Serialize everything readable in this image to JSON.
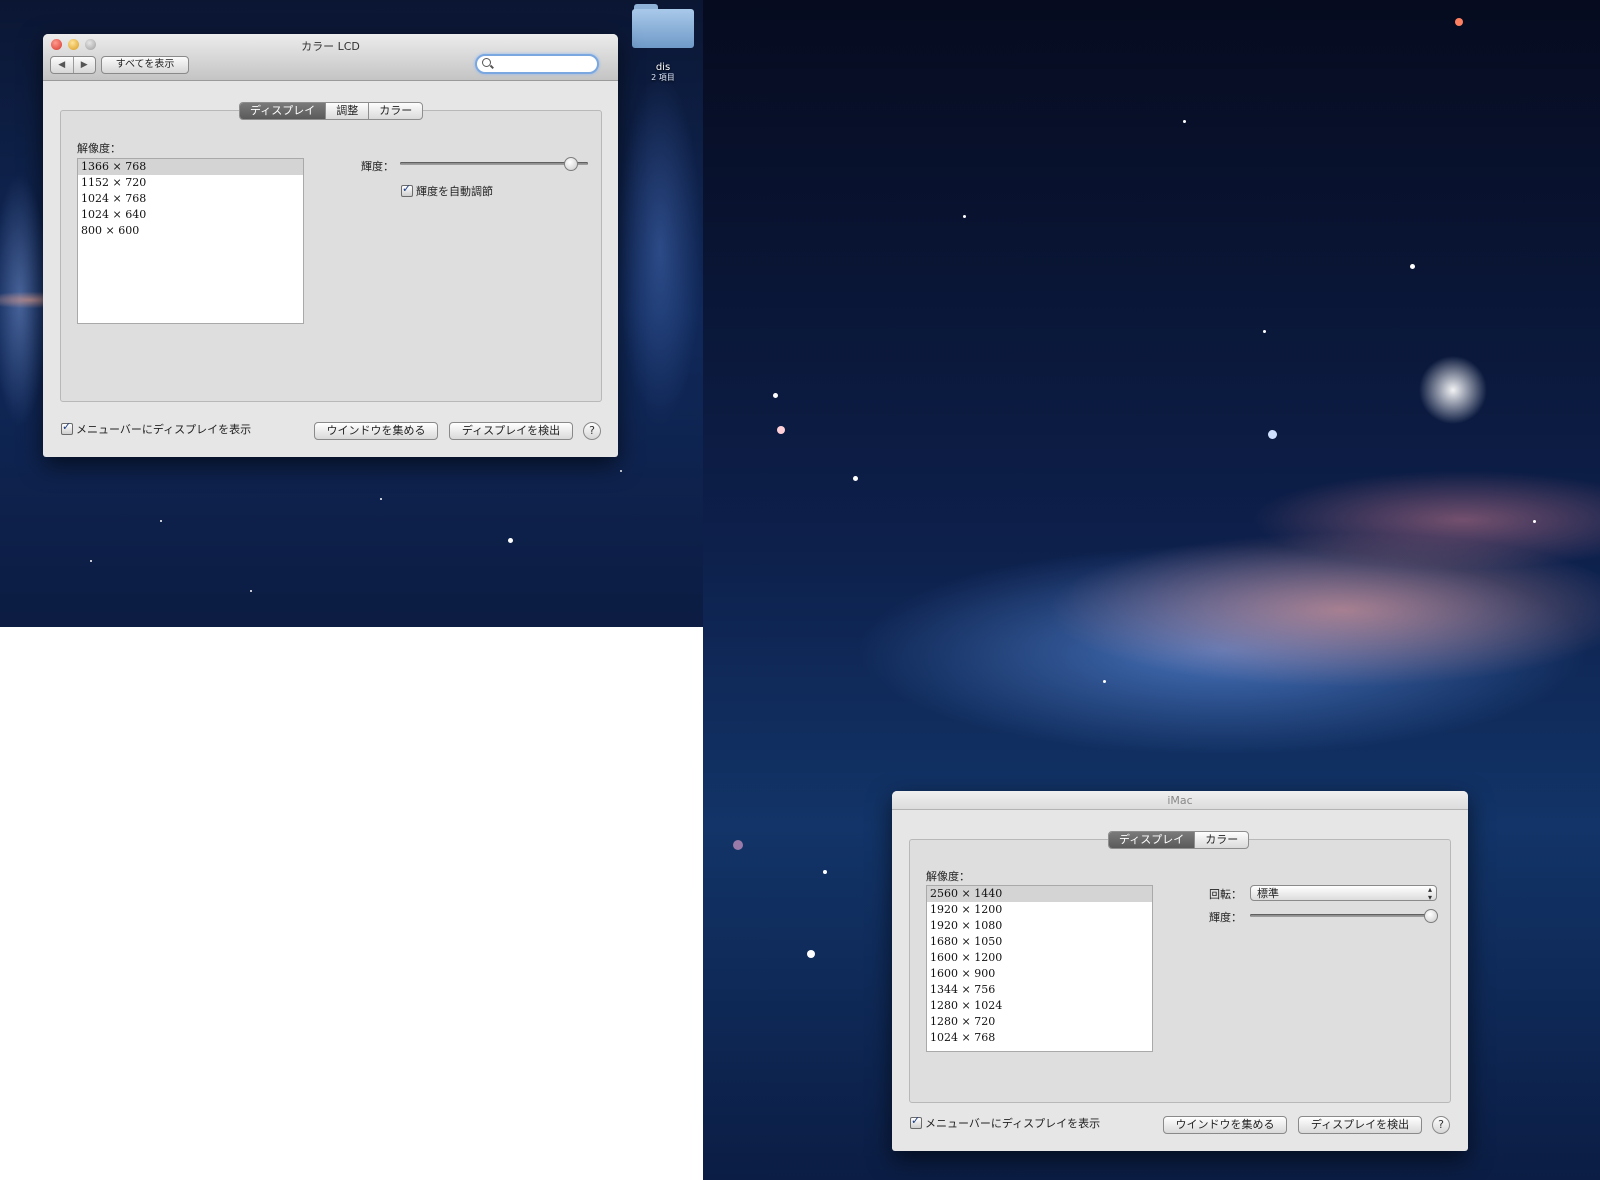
{
  "desktop": {
    "folder": {
      "name": "dis",
      "subtitle": "2 項目",
      "icon": "folder-icon"
    }
  },
  "left_window": {
    "title": "カラー LCD",
    "nav_back": "◀",
    "nav_forward": "▶",
    "show_all_label": "すべてを表示",
    "search_placeholder": "",
    "tabs": [
      "ディスプレイ",
      "調整",
      "カラー"
    ],
    "active_tab": "ディスプレイ",
    "resolution_label": "解像度：",
    "resolutions": [
      "1366 × 768",
      "1152 × 720",
      "1024 × 768",
      "1024 × 640",
      "800 × 600"
    ],
    "selected_resolution": "1366 × 768",
    "brightness_label": "輝度：",
    "brightness_level": 0.95,
    "auto_brightness_label": "輝度を自動調節",
    "auto_brightness_checked": true,
    "menubar_label": "メニューバーにディスプレイを表示",
    "menubar_checked": true,
    "gather_windows_label": "ウインドウを集める",
    "detect_displays_label": "ディスプレイを検出",
    "help_label": "?"
  },
  "right_window": {
    "title": "iMac",
    "tabs": [
      "ディスプレイ",
      "カラー"
    ],
    "active_tab": "ディスプレイ",
    "resolution_label": "解像度：",
    "resolutions": [
      "2560 × 1440",
      "1920 × 1200",
      "1920 × 1080",
      "1680 × 1050",
      "1600 × 1200",
      "1600 × 900",
      "1344 × 756",
      "1280 × 1024",
      "1280 × 720",
      "1024 × 768"
    ],
    "selected_resolution": "2560 × 1440",
    "rotation_label": "回転：",
    "rotation_value": "標準",
    "brightness_label": "輝度：",
    "brightness_level": 1.0,
    "menubar_label": "メニューバーにディスプレイを表示",
    "menubar_checked": true,
    "gather_windows_label": "ウインドウを集める",
    "detect_displays_label": "ディスプレイを検出",
    "help_label": "?"
  }
}
